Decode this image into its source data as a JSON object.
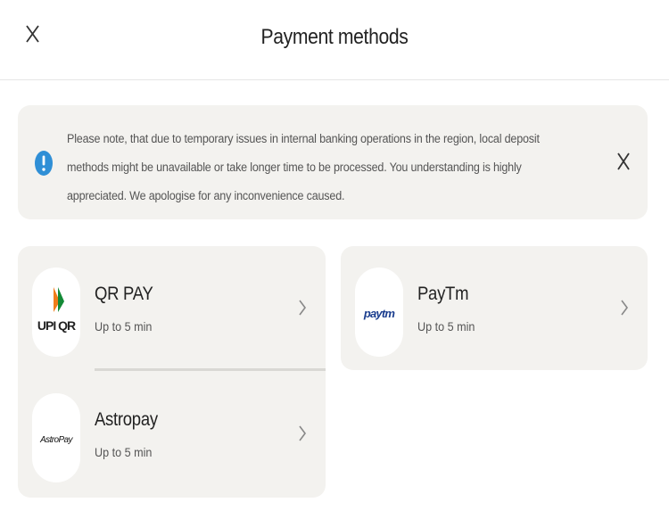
{
  "header": {
    "title": "Payment methods"
  },
  "notice": {
    "text": "Please note, that due to temporary issues in internal banking operations in the region, local deposit methods might be unavailable or take longer time to be processed. You understanding is highly appreciated. We apologise for any inconvenience caused.",
    "icon": "exclamation-circle-icon",
    "accent": "#2f8fd6"
  },
  "methods": [
    {
      "name": "QR PAY",
      "time": "Up to 5 min",
      "logo_text": "UPI QR",
      "icon": "upi-qr-logo"
    },
    {
      "name": "Astropay",
      "time": "Up to 5 min",
      "logo_text": "AstroPay",
      "icon": "astropay-logo"
    },
    {
      "name": "PayTm",
      "time": "Up to 5 min",
      "logo_text": "paytm",
      "icon": "paytm-logo"
    }
  ],
  "colors": {
    "card_bg": "#f3f2ef",
    "paytm_blue": "#1b3e8f",
    "paytm_light": "#2bb3e8",
    "upi_orange": "#f07d1a",
    "upi_green": "#138a36"
  }
}
